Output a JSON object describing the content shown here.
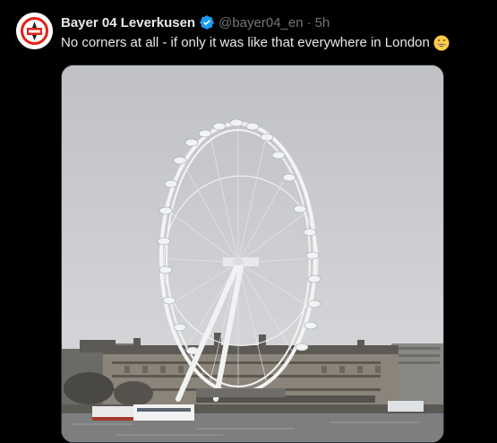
{
  "tweet": {
    "author_name": "Bayer 04 Leverkusen",
    "handle": "@bayer04_en",
    "separator": "·",
    "time": "5h",
    "text": "No corners at all - if only it was like that everywhere in London",
    "emoji": "grinning-face-emoji"
  },
  "media": {
    "icon": "photo-london-eye"
  },
  "colors": {
    "background": "#000000",
    "text": "#e7e9ea",
    "secondary": "#71767b",
    "verified": "#1d9bf0",
    "brand_red": "#e32219"
  }
}
